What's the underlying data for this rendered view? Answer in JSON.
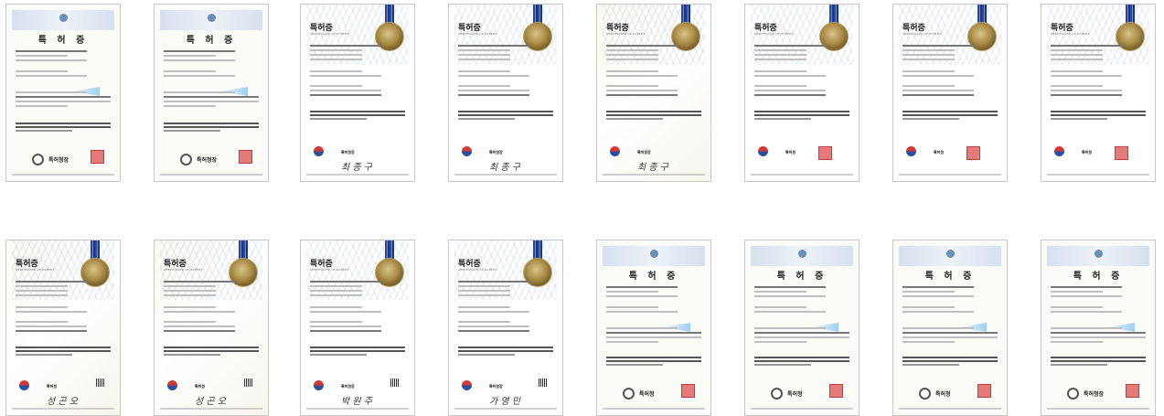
{
  "gallery": {
    "row1": [
      {
        "style": "old",
        "title": "특 허 증",
        "stamp": true,
        "kipo": "특허청장",
        "sig": ""
      },
      {
        "style": "old",
        "title": "특 허 증",
        "stamp": true,
        "kipo": "특허청장",
        "sig": ""
      },
      {
        "style": "new",
        "title": "특허증",
        "subtitle": "CERTIFICATE OF PATENT",
        "kipo": "특허청장",
        "sig": "최 종 구",
        "seal": true
      },
      {
        "style": "new",
        "title": "특허증",
        "subtitle": "CERTIFICATE OF PATENT",
        "kipo": "특허청장",
        "sig": "최 종 구",
        "seal": true
      },
      {
        "style": "cream",
        "title": "특허증",
        "subtitle": "CERTIFICATE OF PATENT",
        "kipo": "특허청장",
        "sig": "최 종 구",
        "seal": true
      },
      {
        "style": "new",
        "title": "특허증",
        "subtitle": "CERTIFICATE OF PATENT",
        "kipo": "특허청",
        "sig": "",
        "seal": true,
        "stamp": true
      },
      {
        "style": "new",
        "title": "특허증",
        "subtitle": "CERTIFICATE OF PATENT",
        "kipo": "특허청",
        "sig": "",
        "seal": true,
        "stamp": true
      },
      {
        "style": "new",
        "title": "특허증",
        "subtitle": "CERTIFICATE OF PATENT",
        "kipo": "특허청",
        "sig": "",
        "seal": true,
        "stamp": true
      }
    ],
    "row2": [
      {
        "style": "cream",
        "title": "특허증",
        "subtitle": "CERTIFICATE OF PATENT",
        "kipo": "특허청",
        "sig": "성 곤 오",
        "seal": true,
        "qr": true
      },
      {
        "style": "cream",
        "title": "특허증",
        "subtitle": "CERTIFICATE OF PATENT",
        "kipo": "특허청",
        "sig": "성 곤 오",
        "seal": true,
        "qr": true
      },
      {
        "style": "new",
        "title": "특허증",
        "subtitle": "CERTIFICATE OF PATENT",
        "kipo": "특허청장",
        "sig": "박 원 주",
        "seal": true,
        "qr": true
      },
      {
        "style": "new",
        "title": "특허증",
        "subtitle": "CERTIFICATE OF PATENT",
        "kipo": "특허청장",
        "sig": "가 영 민",
        "seal": true,
        "qr": true
      },
      {
        "style": "old",
        "title": "특 허 증",
        "stamp": true,
        "kipo": "특허청",
        "sig": ""
      },
      {
        "style": "old",
        "title": "특 허 증",
        "stamp": true,
        "kipo": "특허청",
        "sig": ""
      },
      {
        "style": "old",
        "title": "특 허 증",
        "stamp": true,
        "kipo": "특허청",
        "sig": ""
      },
      {
        "style": "old",
        "title": "특 허 증",
        "stamp": true,
        "kipo": "특허청장",
        "sig": ""
      }
    ]
  },
  "colors": {
    "ribbon": "#2b4a9a",
    "seal_gold": "#a98b45",
    "stamp_red": "#e57a7a"
  }
}
